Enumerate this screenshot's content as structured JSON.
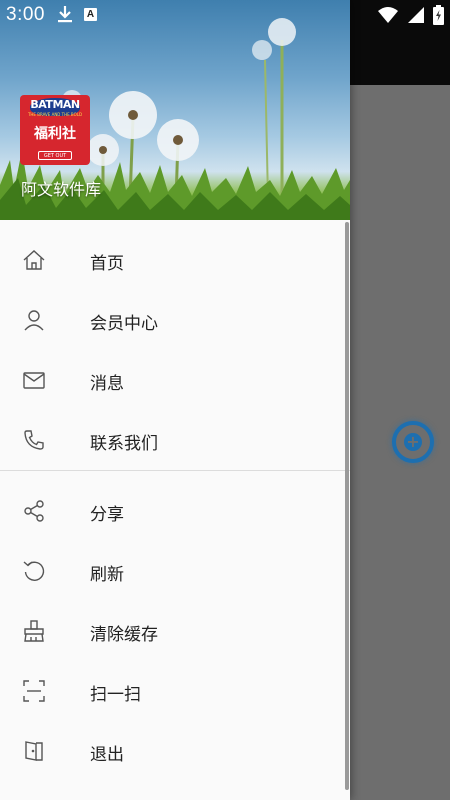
{
  "status_bar": {
    "time": "3:00",
    "a_icon_letter": "A"
  },
  "drawer": {
    "app_name": "阿文软件库",
    "logo": {
      "top_text": "BATMAN",
      "sub_text": "THE BRAVE AND THE BOLD",
      "main_text": "福利社",
      "button_text": "GET OUT"
    },
    "menu_section_1": [
      {
        "label": "首页",
        "icon": "home-icon"
      },
      {
        "label": "会员中心",
        "icon": "person-icon"
      },
      {
        "label": "消息",
        "icon": "mail-icon"
      },
      {
        "label": "联系我们",
        "icon": "phone-icon"
      }
    ],
    "menu_section_2": [
      {
        "label": "分享",
        "icon": "share-icon"
      },
      {
        "label": "刷新",
        "icon": "refresh-icon"
      },
      {
        "label": "清除缓存",
        "icon": "broom-icon"
      },
      {
        "label": "扫一扫",
        "icon": "scan-icon"
      },
      {
        "label": "退出",
        "icon": "exit-icon"
      }
    ]
  },
  "colors": {
    "fab_accent": "#1d6fb0",
    "logo_red": "#d6262e",
    "scrim": "#6e6e6e"
  }
}
